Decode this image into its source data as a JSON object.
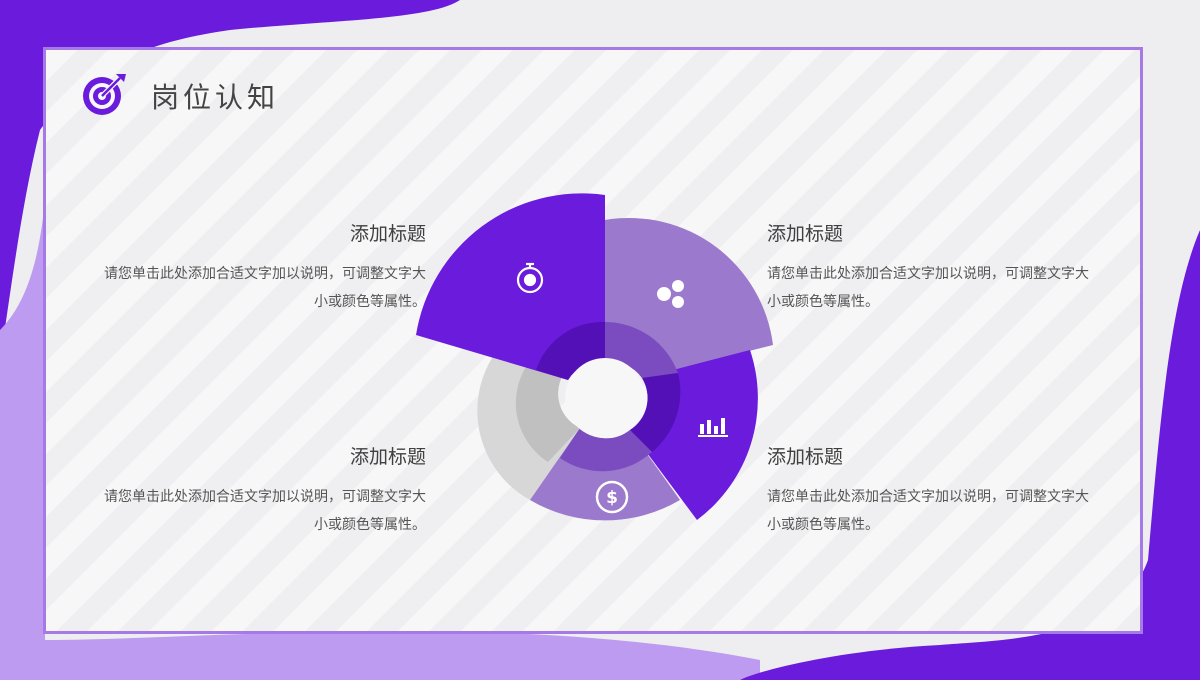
{
  "header": {
    "title": "岗位认知",
    "logo_icon": "target-icon"
  },
  "colors": {
    "accent_dark": "#6a1bdc",
    "accent_mid": "#9b79cc",
    "accent_light": "#bd9bf0",
    "gray": "#d6d6d6"
  },
  "items": [
    {
      "title": "添加标题",
      "desc": "请您单击此处添加合适文字加以说明，可调整文字大小或颜色等属性。",
      "icon": "stopwatch-icon"
    },
    {
      "title": "添加标题",
      "desc": "请您单击此处添加合适文字加以说明，可调整文字大小或颜色等属性。",
      "icon": "team-chat-icon"
    },
    {
      "title": "添加标题",
      "desc": "请您单击此处添加合适文字加以说明，可调整文字大小或颜色等属性。",
      "icon": "dollar-refresh-icon"
    },
    {
      "title": "添加标题",
      "desc": "请您单击此处添加合适文字加以说明，可调整文字大小或颜色等属性。",
      "icon": "bar-growth-icon"
    }
  ]
}
